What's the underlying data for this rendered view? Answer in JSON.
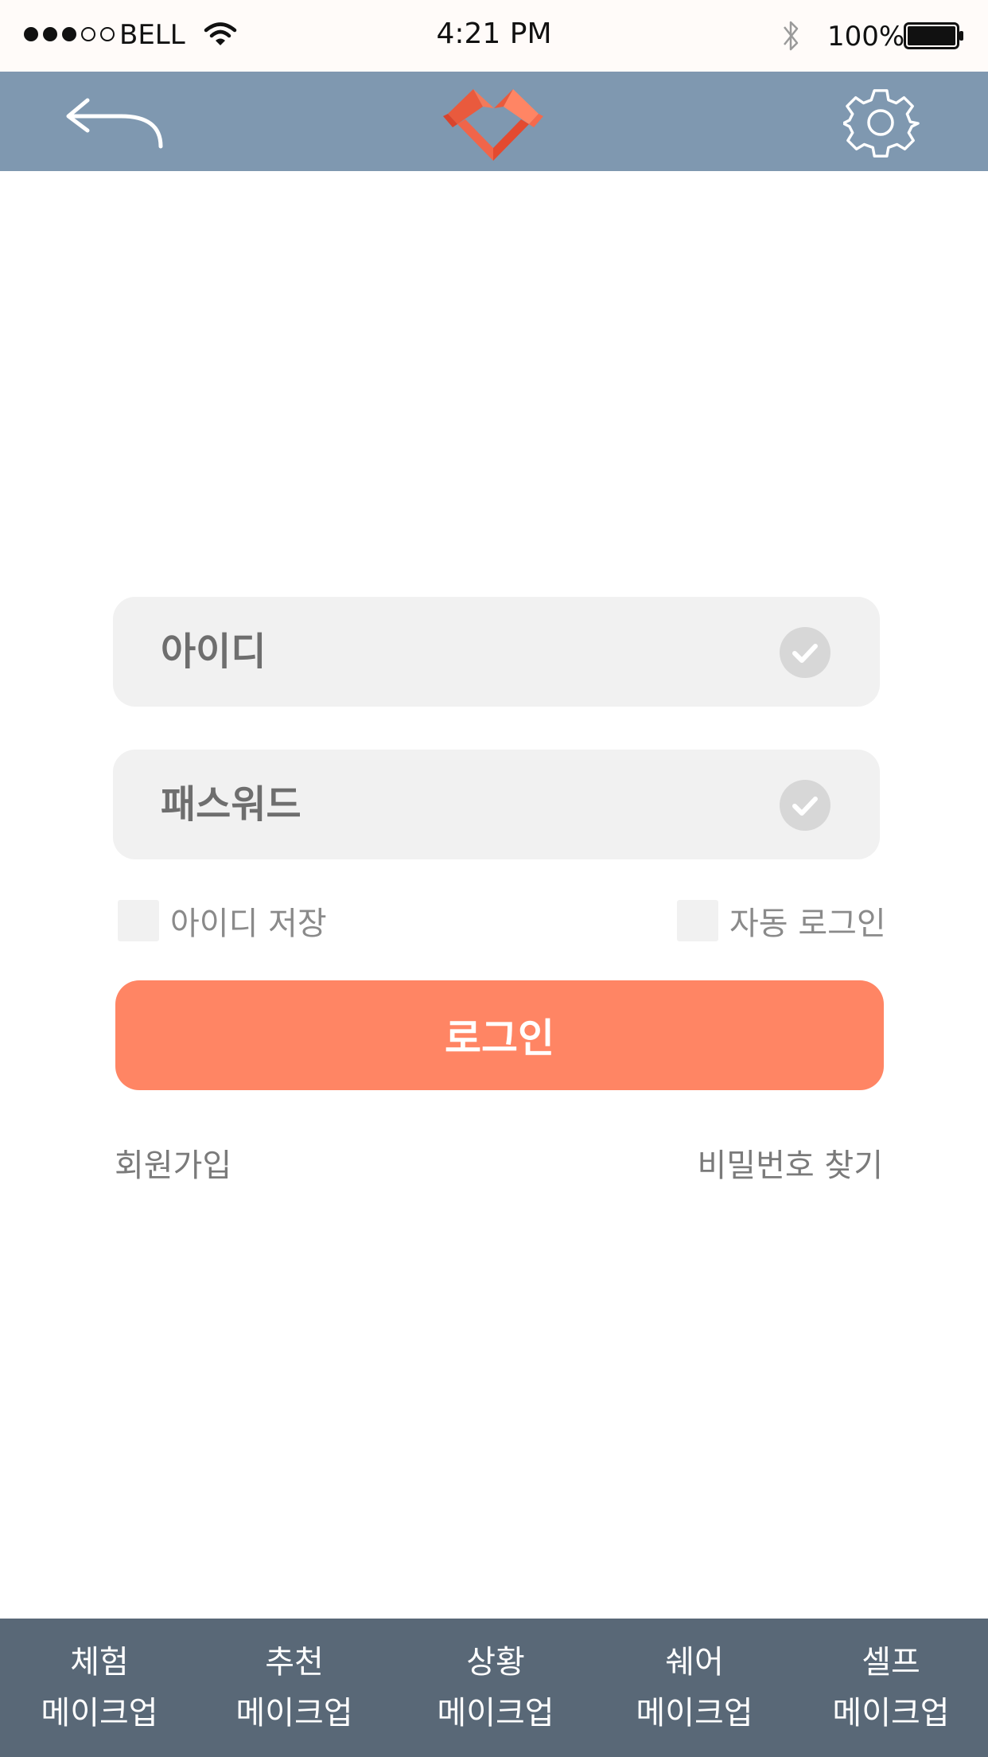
{
  "status_bar": {
    "carrier": "BELL",
    "signal_filled": 3,
    "signal_total": 5,
    "time": "4:21 PM",
    "battery": "100%"
  },
  "header": {
    "back_icon": "back-arrow-icon",
    "logo_icon": "origami-heart-logo",
    "settings_icon": "gear-icon",
    "color": "#7f98b0"
  },
  "login": {
    "id_placeholder": "아이디",
    "password_placeholder": "패스워드",
    "save_id_label": "아이디 저장",
    "auto_login_label": "자동 로그인",
    "submit_label": "로그인",
    "signup_link": "회원가입",
    "find_password_link": "비밀번호 찾기",
    "accent_color": "#ff8564"
  },
  "bottom_nav": {
    "color": "#596877",
    "items": [
      {
        "line1": "체험",
        "line2": "메이크업"
      },
      {
        "line1": "추천",
        "line2": "메이크업"
      },
      {
        "line1": "상황",
        "line2": "메이크업"
      },
      {
        "line1": "쉐어",
        "line2": "메이크업"
      },
      {
        "line1": "셀프",
        "line2": "메이크업"
      }
    ]
  }
}
